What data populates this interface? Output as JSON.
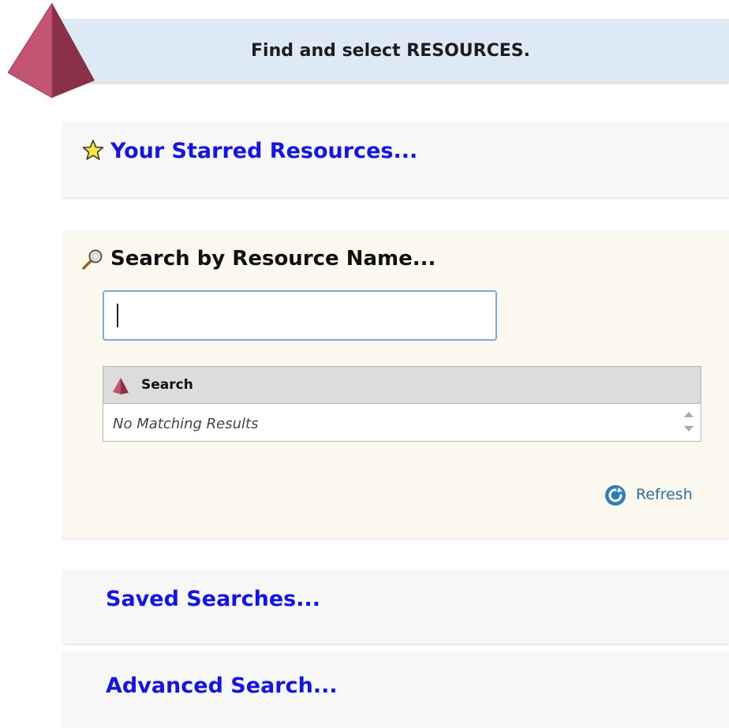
{
  "header": {
    "title": "Find and select RESOURCES.",
    "logo_color": "#a5425a",
    "banner_color": "#dde9f4"
  },
  "starred": {
    "label": "Your Starred Resources...",
    "icon": "star-icon"
  },
  "search_by_name": {
    "heading": "Search by Resource Name...",
    "icon": "magnifier-icon",
    "input_value": "",
    "results": {
      "column_header": "Search",
      "empty_text": "No Matching Results"
    },
    "refresh_label": "Refresh"
  },
  "saved_searches": {
    "label": "Saved Searches..."
  },
  "advanced_search": {
    "label": "Advanced Search..."
  },
  "colors": {
    "link": "#1414e6",
    "search_panel_bg": "#fbf8f0",
    "section_bg": "#f7f7f7"
  }
}
